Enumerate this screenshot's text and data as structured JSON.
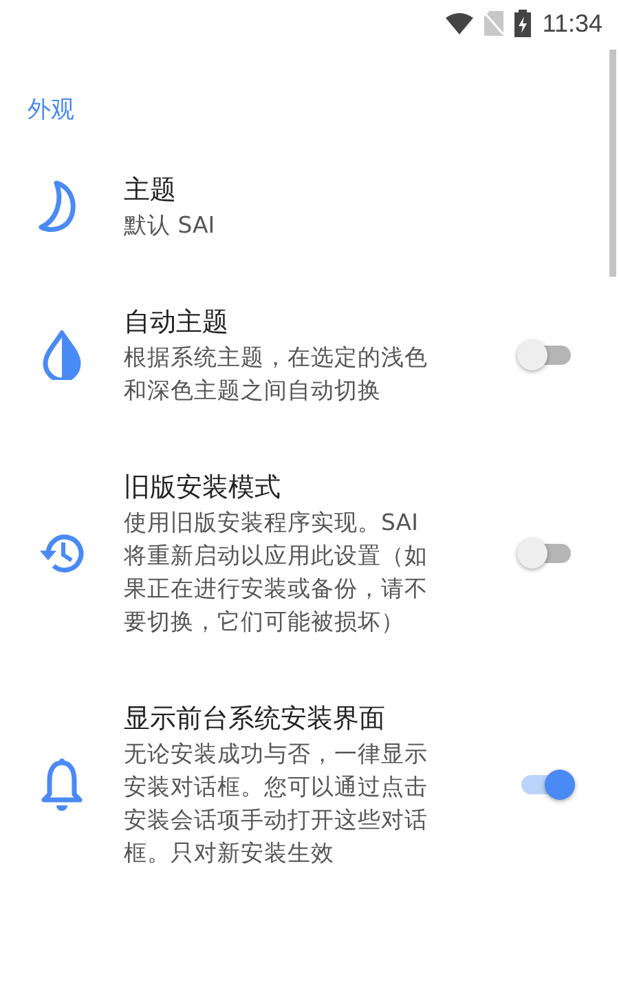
{
  "status_bar": {
    "time": "11:34"
  },
  "section": {
    "title": "外观"
  },
  "settings": [
    {
      "kind": "plain",
      "title": "主题",
      "summary": "默认 SAI"
    },
    {
      "kind": "switch",
      "title": "自动主题",
      "summary": "根据系统主题，在选定的浅色和深色主题之间自动切换",
      "on": false
    },
    {
      "kind": "switch",
      "title": "旧版安装模式",
      "summary": "使用旧版安装程序实现。SAI将重新启动以应用此设置（如果正在进行安装或备份，请不要切换，它们可能被损坏）",
      "on": false
    },
    {
      "kind": "switch",
      "title": "显示前台系统安装界面",
      "summary": "无论安装成功与否，一律显示安装对话框。您可以通过点击安装会话项手动打开这些对话框。只对新安装生效",
      "on": true
    }
  ]
}
